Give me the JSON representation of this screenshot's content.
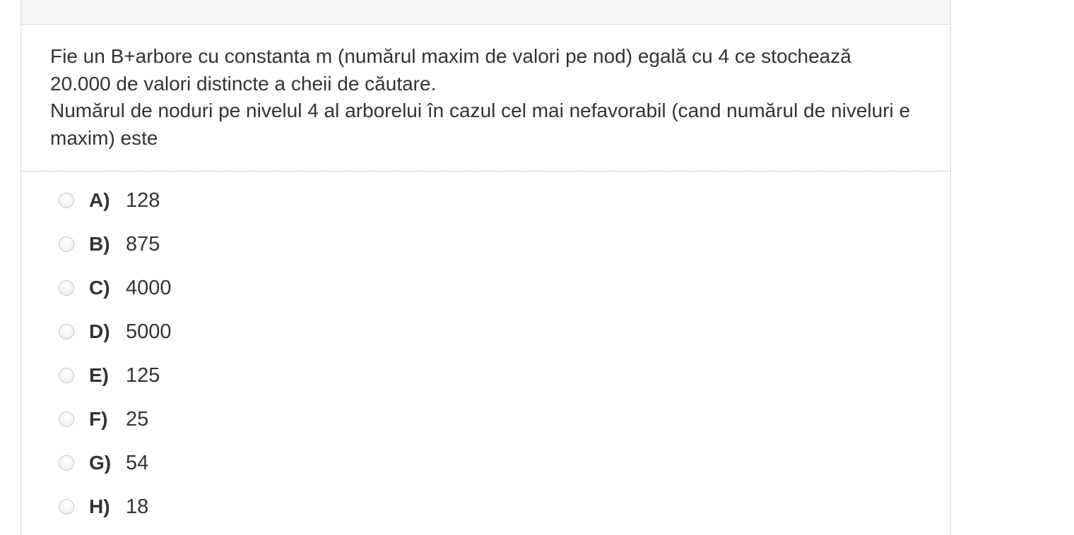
{
  "question": {
    "line1": "Fie un B+arbore cu constanta m (numărul maxim de valori pe nod) egală cu 4 ce stochează 20.000 de valori distincte a cheii de căutare.",
    "line2": "Numărul de noduri pe nivelul 4 al arborelui în cazul cel mai nefavorabil (cand numărul de niveluri e maxim) este"
  },
  "answers": [
    {
      "letter": "A)",
      "value": "128"
    },
    {
      "letter": "B)",
      "value": "875"
    },
    {
      "letter": "C)",
      "value": "4000"
    },
    {
      "letter": "D)",
      "value": "5000"
    },
    {
      "letter": "E)",
      "value": "125"
    },
    {
      "letter": "F)",
      "value": "25"
    },
    {
      "letter": "G)",
      "value": "54"
    },
    {
      "letter": "H)",
      "value": "18"
    }
  ],
  "colors": {
    "text": "#333333",
    "header_bg": "#f5f5f5",
    "border": "#dddddd"
  }
}
